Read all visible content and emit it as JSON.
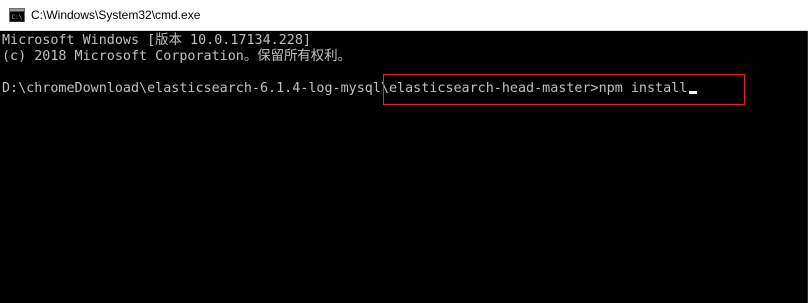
{
  "window": {
    "title": "C:\\Windows\\System32\\cmd.exe",
    "icon": "cmd-icon"
  },
  "console": {
    "lines": [
      "Microsoft Windows [版本 10.0.17134.228]",
      "(c) 2018 Microsoft Corporation。保留所有权利。",
      "D:\\chromeDownload\\elasticsearch-6.1.4-log-mysql\\elasticsearch-head-master>npm install"
    ],
    "text_color": "#c0c0c0",
    "background_color": "#000000"
  },
  "annotation": {
    "highlight_color": "#e0262b"
  }
}
